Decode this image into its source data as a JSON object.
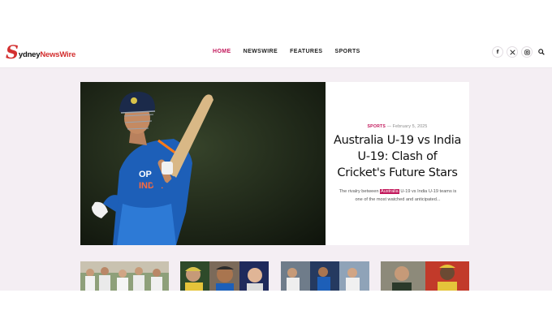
{
  "brand": {
    "logo_initial": "S",
    "logo_first": "ydney",
    "logo_second": "NewsWire"
  },
  "nav": {
    "items": [
      {
        "label": "HOME",
        "active": true
      },
      {
        "label": "NEWSWIRE",
        "active": false
      },
      {
        "label": "FEATURES",
        "active": false
      },
      {
        "label": "SPORTS",
        "active": false
      }
    ]
  },
  "social": {
    "facebook": "f",
    "x": "𝕏",
    "instagram": "◎",
    "icons": [
      "facebook-icon",
      "x-icon",
      "instagram-icon",
      "search-icon"
    ]
  },
  "featured": {
    "category": "SPORTS",
    "separator": "—",
    "date": "February 5, 2025",
    "title": "Australia U-19 vs India U-19: Clash of Cricket's Future Stars",
    "excerpt_before": "The rivalry between ",
    "excerpt_highlight": "Australia",
    "excerpt_after": " U-19 vs India U-19 teams is one of the most watched and anticipated..."
  },
  "colors": {
    "accent": "#c2185b",
    "logo_red": "#d32f2f",
    "content_bg": "#f4eef3"
  }
}
